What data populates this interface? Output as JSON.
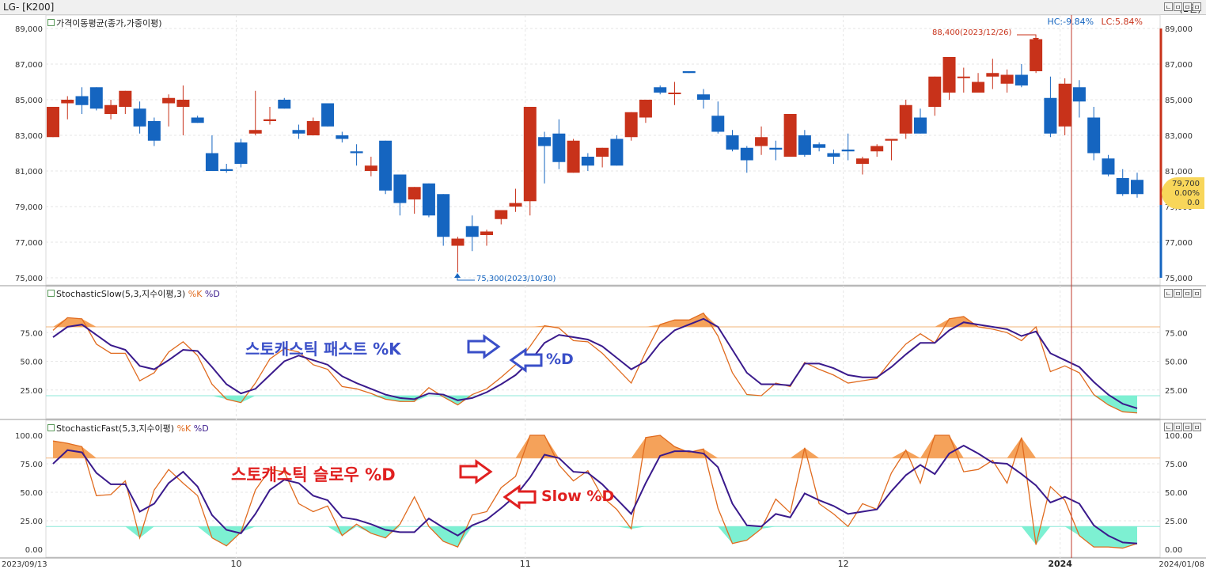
{
  "window": {
    "title": "LG- [K200]",
    "period": "(1일)"
  },
  "panel_buttons": [
    "ㄴ",
    "ㅁ",
    "ㅁ",
    "ㅁ"
  ],
  "price_panel": {
    "legend": "가격이동평균(종가,가중이평)",
    "hc_label": "HC:-9.84%",
    "lc_label": "LC:5.84%",
    "high_annotation": "88,400(2023/12/26)",
    "low_annotation": "75,300(2023/10/30)",
    "y_ticks": [
      "89,000",
      "87,000",
      "85,000",
      "83,000",
      "81,000",
      "79,000",
      "77,000",
      "75,000"
    ],
    "current_price": "79,700",
    "current_change": "0.00%",
    "current_volume": "0.0"
  },
  "slow_panel": {
    "legend_name": "StochasticSlow(5,3,지수이평,3)",
    "legend_k": "%K",
    "legend_d": "%D",
    "y_ticks": [
      "75.00",
      "50.00",
      "25.00"
    ],
    "annotation_main": "스토캐스틱 패스트  %K",
    "annotation_sub": "%D"
  },
  "fast_panel": {
    "legend_name": "StochasticFast(5,3,지수이평)",
    "legend_k": "%K",
    "legend_d": "%D",
    "y_ticks": [
      "100.00",
      "75.00",
      "50.00",
      "25.00",
      "0.00"
    ],
    "annotation_main": "스토캐스틱 슬로우  %D",
    "annotation_sub": "Slow %D"
  },
  "x_axis": {
    "start_label": "2023/09/13",
    "month_labels": [
      "10",
      "11",
      "12",
      "2024"
    ],
    "end_label": "2024/01/08"
  },
  "colors": {
    "up": "#c8321a",
    "down": "#1565c0",
    "k_line": "#e06b1f",
    "d_line": "#3a1a8c",
    "overbought_fill": "#f5a25a",
    "oversold_fill": "#7df0d2",
    "cursor": "#c0392b",
    "annotation_blue": "#3a4fc8",
    "annotation_red": "#e02020"
  },
  "chart_data": [
    {
      "type": "candlestick",
      "title": "LG- [K200]",
      "ylim": [
        75000,
        89000
      ],
      "candles": [
        {
          "o": 82900,
          "h": 84600,
          "l": 82900,
          "c": 84600
        },
        {
          "o": 84800,
          "h": 85200,
          "l": 83900,
          "c": 85000
        },
        {
          "o": 85200,
          "h": 85700,
          "l": 84200,
          "c": 84700
        },
        {
          "o": 85700,
          "h": 85700,
          "l": 84400,
          "c": 84500
        },
        {
          "o": 84200,
          "h": 85000,
          "l": 83900,
          "c": 84700
        },
        {
          "o": 84600,
          "h": 85500,
          "l": 84200,
          "c": 85500
        },
        {
          "o": 84500,
          "h": 84900,
          "l": 83100,
          "c": 83500
        },
        {
          "o": 83800,
          "h": 84000,
          "l": 82400,
          "c": 82700
        },
        {
          "o": 84800,
          "h": 85300,
          "l": 83500,
          "c": 85100
        },
        {
          "o": 84600,
          "h": 85800,
          "l": 83000,
          "c": 85000
        },
        {
          "o": 84000,
          "h": 84100,
          "l": 83700,
          "c": 83700
        },
        {
          "o": 82000,
          "h": 83000,
          "l": 81000,
          "c": 81000
        },
        {
          "o": 81100,
          "h": 81400,
          "l": 80900,
          "c": 81000
        },
        {
          "o": 82600,
          "h": 82800,
          "l": 81200,
          "c": 81400
        },
        {
          "o": 83100,
          "h": 85500,
          "l": 83000,
          "c": 83300
        },
        {
          "o": 83800,
          "h": 84600,
          "l": 83600,
          "c": 83900
        },
        {
          "o": 85000,
          "h": 85100,
          "l": 84500,
          "c": 84500
        },
        {
          "o": 83300,
          "h": 83600,
          "l": 82800,
          "c": 83100
        },
        {
          "o": 83000,
          "h": 84000,
          "l": 83000,
          "c": 83800
        },
        {
          "o": 84800,
          "h": 84800,
          "l": 83500,
          "c": 83500
        },
        {
          "o": 83000,
          "h": 83200,
          "l": 82600,
          "c": 82800
        },
        {
          "o": 82100,
          "h": 82500,
          "l": 81300,
          "c": 82000
        },
        {
          "o": 81000,
          "h": 81800,
          "l": 80700,
          "c": 81300
        },
        {
          "o": 82700,
          "h": 82700,
          "l": 79700,
          "c": 79900
        },
        {
          "o": 80800,
          "h": 80800,
          "l": 78500,
          "c": 79200
        },
        {
          "o": 79400,
          "h": 80100,
          "l": 78600,
          "c": 80100
        },
        {
          "o": 80300,
          "h": 80300,
          "l": 78400,
          "c": 78500
        },
        {
          "o": 79700,
          "h": 79700,
          "l": 76800,
          "c": 77300
        },
        {
          "o": 76800,
          "h": 77300,
          "l": 75300,
          "c": 77200
        },
        {
          "o": 77900,
          "h": 78500,
          "l": 76500,
          "c": 77300
        },
        {
          "o": 77400,
          "h": 77700,
          "l": 76800,
          "c": 77600
        },
        {
          "o": 78300,
          "h": 78800,
          "l": 78000,
          "c": 78800
        },
        {
          "o": 79000,
          "h": 80000,
          "l": 78700,
          "c": 79200
        },
        {
          "o": 79300,
          "h": 84600,
          "l": 78500,
          "c": 84600
        },
        {
          "o": 82900,
          "h": 83200,
          "l": 80300,
          "c": 82400
        },
        {
          "o": 83100,
          "h": 83900,
          "l": 81100,
          "c": 81500
        },
        {
          "o": 80900,
          "h": 82800,
          "l": 80900,
          "c": 82700
        },
        {
          "o": 81800,
          "h": 82000,
          "l": 81000,
          "c": 81300
        },
        {
          "o": 81800,
          "h": 82300,
          "l": 81200,
          "c": 82300
        },
        {
          "o": 82800,
          "h": 83000,
          "l": 81300,
          "c": 81300
        },
        {
          "o": 82900,
          "h": 84300,
          "l": 82700,
          "c": 84300
        },
        {
          "o": 84000,
          "h": 85000,
          "l": 83700,
          "c": 85000
        },
        {
          "o": 85700,
          "h": 85800,
          "l": 85300,
          "c": 85400
        },
        {
          "o": 85400,
          "h": 86000,
          "l": 84700,
          "c": 85400
        },
        {
          "o": 86600,
          "h": 86600,
          "l": 86500,
          "c": 86500
        },
        {
          "o": 85300,
          "h": 85600,
          "l": 84500,
          "c": 85000
        },
        {
          "o": 84100,
          "h": 84900,
          "l": 83100,
          "c": 83200
        },
        {
          "o": 83000,
          "h": 83300,
          "l": 82100,
          "c": 82200
        },
        {
          "o": 82300,
          "h": 82400,
          "l": 80900,
          "c": 81600
        },
        {
          "o": 82400,
          "h": 83500,
          "l": 81900,
          "c": 82900
        },
        {
          "o": 82300,
          "h": 82700,
          "l": 81600,
          "c": 82200
        },
        {
          "o": 81800,
          "h": 84200,
          "l": 81800,
          "c": 84200
        },
        {
          "o": 83000,
          "h": 83300,
          "l": 81800,
          "c": 81900
        },
        {
          "o": 82500,
          "h": 82600,
          "l": 82100,
          "c": 82300
        },
        {
          "o": 82000,
          "h": 82200,
          "l": 81400,
          "c": 81800
        },
        {
          "o": 82200,
          "h": 83100,
          "l": 81600,
          "c": 82100
        },
        {
          "o": 81400,
          "h": 81800,
          "l": 80800,
          "c": 81700
        },
        {
          "o": 82100,
          "h": 82500,
          "l": 81800,
          "c": 82400
        },
        {
          "o": 82700,
          "h": 82800,
          "l": 81600,
          "c": 82800
        },
        {
          "o": 83100,
          "h": 85000,
          "l": 82800,
          "c": 84700
        },
        {
          "o": 84000,
          "h": 84500,
          "l": 83100,
          "c": 83100
        },
        {
          "o": 84600,
          "h": 86300,
          "l": 84100,
          "c": 86300
        },
        {
          "o": 85400,
          "h": 87400,
          "l": 85000,
          "c": 87400
        },
        {
          "o": 86300,
          "h": 86800,
          "l": 85400,
          "c": 86300
        },
        {
          "o": 85400,
          "h": 86500,
          "l": 85400,
          "c": 86000
        },
        {
          "o": 86300,
          "h": 87300,
          "l": 85600,
          "c": 86500
        },
        {
          "o": 85900,
          "h": 86700,
          "l": 85400,
          "c": 86400
        },
        {
          "o": 86400,
          "h": 87000,
          "l": 85700,
          "c": 85800
        },
        {
          "o": 86600,
          "h": 88400,
          "l": 86500,
          "c": 88400
        },
        {
          "o": 85100,
          "h": 86300,
          "l": 82900,
          "c": 83100
        },
        {
          "o": 83500,
          "h": 86200,
          "l": 83000,
          "c": 85900
        },
        {
          "o": 85700,
          "h": 86100,
          "l": 84000,
          "c": 84900
        },
        {
          "o": 84000,
          "h": 84600,
          "l": 81600,
          "c": 82000
        },
        {
          "o": 81700,
          "h": 81900,
          "l": 80700,
          "c": 80800
        },
        {
          "o": 80600,
          "h": 81100,
          "l": 79600,
          "c": 79700
        },
        {
          "o": 80500,
          "h": 80900,
          "l": 79500,
          "c": 79700
        }
      ]
    },
    {
      "type": "line",
      "title": "StochasticSlow(5,3,지수이평,3)",
      "ylim": [
        0,
        100
      ],
      "reference_lines": [
        80,
        20
      ],
      "series": [
        {
          "name": "%K",
          "values": [
            77,
            88,
            87,
            65,
            57,
            57,
            33,
            40,
            58,
            67,
            55,
            30,
            17,
            14,
            31,
            52,
            61,
            58,
            47,
            43,
            28,
            26,
            22,
            17,
            15,
            15,
            27,
            19,
            12,
            21,
            26,
            36,
            47,
            63,
            81,
            79,
            68,
            67,
            57,
            44,
            31,
            58,
            82,
            86,
            86,
            92,
            72,
            40,
            21,
            20,
            31,
            28,
            49,
            43,
            38,
            31,
            33,
            35,
            51,
            65,
            74,
            66,
            87,
            89,
            80,
            78,
            75,
            68,
            80,
            41,
            46,
            40,
            21,
            12,
            6,
            5
          ]
        },
        {
          "name": "%D",
          "values": [
            71,
            80,
            82,
            73,
            64,
            60,
            46,
            43,
            51,
            60,
            59,
            45,
            30,
            22,
            26,
            38,
            50,
            55,
            51,
            47,
            37,
            31,
            26,
            21,
            18,
            17,
            22,
            21,
            16,
            18,
            23,
            30,
            38,
            50,
            66,
            73,
            71,
            69,
            63,
            53,
            43,
            50,
            66,
            77,
            82,
            87,
            80,
            60,
            40,
            30,
            30,
            29,
            48,
            48,
            44,
            38,
            36,
            36,
            45,
            56,
            66,
            66,
            77,
            84,
            82,
            80,
            78,
            72,
            76,
            57,
            51,
            45,
            32,
            21,
            13,
            9
          ]
        }
      ]
    },
    {
      "type": "line",
      "title": "StochasticFast(5,3,지수이평)",
      "ylim": [
        0,
        100
      ],
      "reference_lines": [
        80,
        20
      ],
      "series": [
        {
          "name": "%K",
          "values": [
            95,
            93,
            90,
            47,
            48,
            60,
            10,
            52,
            70,
            58,
            47,
            10,
            3,
            15,
            52,
            70,
            68,
            40,
            33,
            38,
            12,
            22,
            14,
            10,
            22,
            46,
            20,
            7,
            2,
            30,
            33,
            54,
            64,
            100,
            100,
            74,
            60,
            69,
            46,
            35,
            18,
            98,
            100,
            90,
            85,
            88,
            36,
            5,
            8,
            18,
            44,
            32,
            89,
            40,
            31,
            20,
            40,
            35,
            67,
            87,
            58,
            100,
            100,
            68,
            70,
            78,
            58,
            98,
            4,
            55,
            43,
            12,
            2,
            2,
            1,
            5
          ]
        },
        {
          "name": "%D",
          "values": [
            75,
            87,
            85,
            67,
            57,
            57,
            33,
            40,
            58,
            68,
            55,
            30,
            17,
            14,
            31,
            52,
            61,
            58,
            47,
            43,
            28,
            26,
            22,
            17,
            15,
            15,
            27,
            19,
            12,
            21,
            26,
            36,
            47,
            63,
            83,
            80,
            68,
            67,
            57,
            44,
            31,
            58,
            82,
            86,
            86,
            84,
            72,
            40,
            21,
            20,
            31,
            28,
            49,
            43,
            38,
            31,
            33,
            35,
            51,
            65,
            74,
            66,
            84,
            91,
            84,
            76,
            75,
            66,
            56,
            41,
            46,
            40,
            21,
            12,
            6,
            5
          ]
        }
      ]
    }
  ]
}
